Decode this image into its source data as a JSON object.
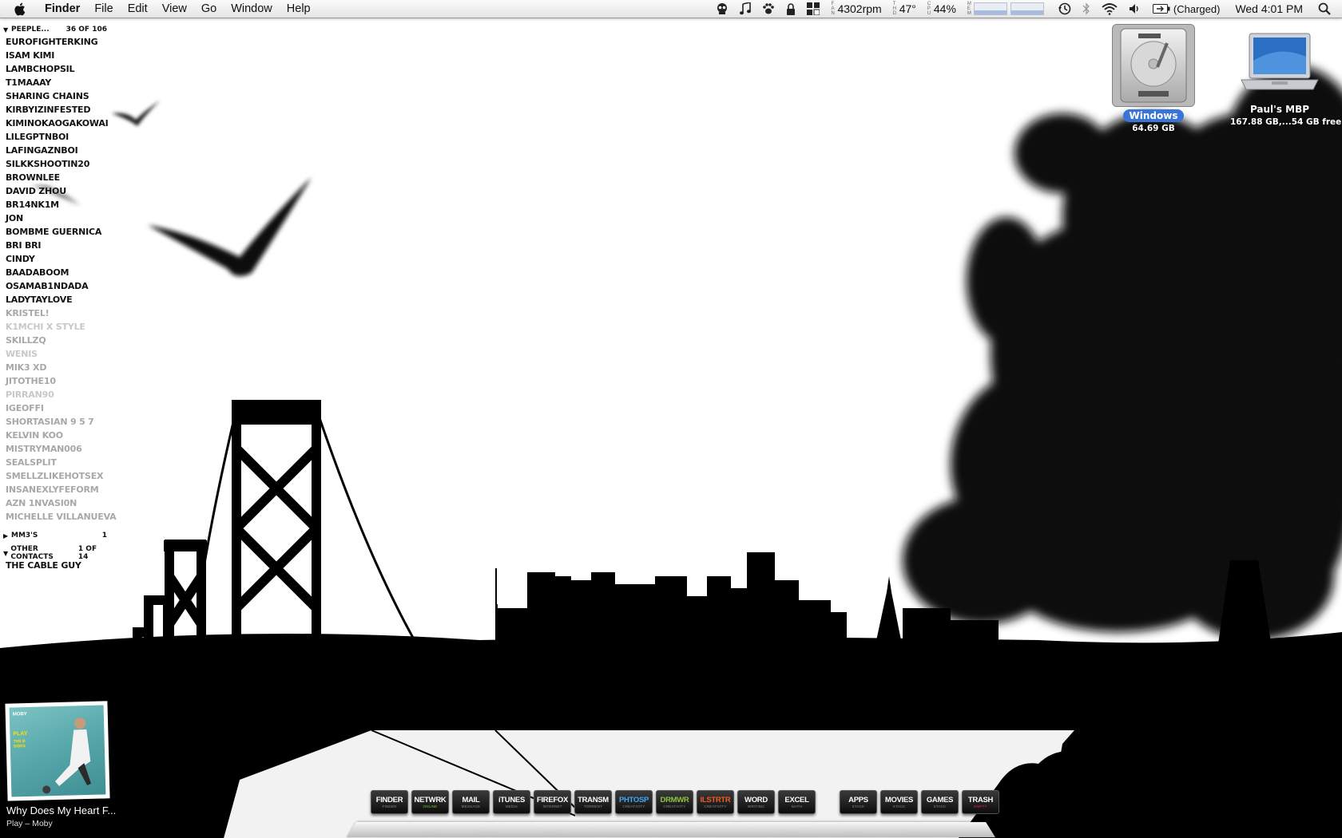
{
  "menubar": {
    "apple_icon": "apple-logo-icon",
    "menus": [
      "Finder",
      "File",
      "Edit",
      "View",
      "Go",
      "Window",
      "Help"
    ],
    "status": {
      "fan_speed": "4302rpm",
      "temperature": "47°",
      "cpu_usage": "44%",
      "fan_label": "FAN",
      "temp_label": "THD",
      "cpu_label": "CPU",
      "mem_label": "MEM",
      "battery": "(Charged)",
      "clock": "Wed 4:01 PM"
    }
  },
  "contacts": {
    "group1": {
      "name": "PEEPLE...",
      "count": "36 OF 106"
    },
    "online": [
      "EUROFIGHTERKING",
      "ISAM KIMI",
      "LAMBCHOPSIL",
      "T1MAAAY",
      "SHARING CHAINS",
      "KIRBYIZINFESTED",
      "KIMINOKAOGAKOWAI",
      "LILEGPTNBOI",
      "LAFINGAZNBOI",
      "SILKKSHOOTIN20",
      "BROWNLEE",
      "DAVID ZHOU",
      "BR14NK1M",
      "JON",
      "BOMBME GUERNICA",
      "BRI BRI",
      "CINDY",
      "BAADABOOM",
      "OSAMAB1NDADA",
      "LADYTAYLOVE"
    ],
    "mixed": [
      {
        "name": "KRISTEL!",
        "state": "offline"
      },
      {
        "name": "K1MCHI X STYLE",
        "state": "idle"
      },
      {
        "name": "SKILLZQ",
        "state": "offline"
      },
      {
        "name": "WENIS",
        "state": "idle"
      },
      {
        "name": "MIK3 XD",
        "state": "offline"
      },
      {
        "name": "JITOTHE10",
        "state": "offline"
      },
      {
        "name": "PIRRAN90",
        "state": "idle"
      },
      {
        "name": "IGEOFFI",
        "state": "offline"
      },
      {
        "name": "SHORTASIAN 9 5 7",
        "state": "offline"
      },
      {
        "name": "KELVIN KOO",
        "state": "offline"
      },
      {
        "name": "MISTRYMAN006",
        "state": "offline"
      },
      {
        "name": "SEALSPLIT",
        "state": "offline"
      },
      {
        "name": "SMELLZLIKEHOTSEX",
        "state": "offline"
      },
      {
        "name": "INSANEXLYFEFORM",
        "state": "offline"
      },
      {
        "name": "AZN 1NVASI0N",
        "state": "offline"
      },
      {
        "name": "MICHELLE VILLANUEVA",
        "state": "offline"
      }
    ],
    "group2": {
      "name": "MM3'S",
      "count": "1"
    },
    "group3": {
      "name": "OTHER CONTACTS",
      "count": "1 OF 14"
    },
    "other": [
      "THE CABLE GUY"
    ]
  },
  "desktop": {
    "drives": [
      {
        "name": "Windows",
        "info": "64.69 GB",
        "icon": "hard-drive-icon"
      },
      {
        "name": "Paul's MBP",
        "info": "167.88 GB,...54 GB free",
        "icon": "laptop-icon"
      }
    ]
  },
  "now_playing": {
    "title": "Why Does My Heart F...",
    "subtitle": "Play – Moby",
    "album_text_1": "MOBY",
    "album_text_2": "PLAY",
    "album_text_3": "THE B SIDES"
  },
  "dock": {
    "items": [
      {
        "label": "FINDER",
        "sub": "FINDER",
        "color": "#ffffff"
      },
      {
        "label": "NETWRK",
        "sub": "ONLINE",
        "color": "#ffffff",
        "sub_color": "#6ecf2c"
      },
      {
        "label": "MAIL",
        "sub": "MESSAGE",
        "color": "#ffffff"
      },
      {
        "label": "iTUNES",
        "sub": "MEDIA",
        "color": "#ffffff"
      },
      {
        "label": "FIREFOX",
        "sub": "INTERNET",
        "color": "#ffffff"
      },
      {
        "label": "TRANSM",
        "sub": "TORRENT",
        "color": "#ffffff"
      },
      {
        "label": "PHTOSP",
        "sub": "CREATIVITY",
        "color": "#3fa9f5"
      },
      {
        "label": "DRMWR",
        "sub": "CREATIVITY",
        "color": "#8dc63f"
      },
      {
        "label": "ILSTRTR",
        "sub": "CREATIVITY",
        "color": "#f15a24"
      },
      {
        "label": "WORD",
        "sub": "WRITING",
        "color": "#ffffff"
      },
      {
        "label": "EXCEL",
        "sub": "MATH",
        "color": "#ffffff"
      }
    ],
    "stacks": [
      {
        "label": "APPS",
        "sub": "STACK"
      },
      {
        "label": "MOVIES",
        "sub": "STACK"
      },
      {
        "label": "GAMES",
        "sub": "STACK"
      },
      {
        "label": "TRASH",
        "sub": "EMPTY",
        "sub_color": "#e0245e"
      }
    ]
  }
}
